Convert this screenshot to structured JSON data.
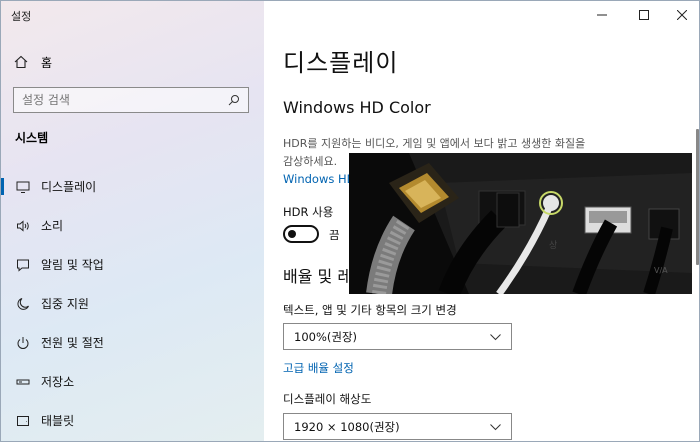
{
  "window": {
    "title": "설정"
  },
  "sidebar": {
    "home_label": "홈",
    "search_placeholder": "설정 검색",
    "section_title": "시스템",
    "items": [
      {
        "label": "디스플레이",
        "icon": "monitor-icon",
        "active": true
      },
      {
        "label": "소리",
        "icon": "speaker-icon"
      },
      {
        "label": "알림 및 작업",
        "icon": "notification-icon"
      },
      {
        "label": "집중 지원",
        "icon": "moon-icon"
      },
      {
        "label": "전원 및 절전",
        "icon": "power-icon"
      },
      {
        "label": "저장소",
        "icon": "storage-icon"
      },
      {
        "label": "태블릿",
        "icon": "tablet-icon"
      }
    ]
  },
  "main": {
    "title": "디스플레이",
    "hd_color_heading": "Windows HD Color",
    "hd_color_desc": "HDR를 지원하는 비디오, 게임 및 앱에서 보다 밝고 생생한 화질을 감상하세요.",
    "hd_color_link": "Windows HD",
    "hdr_label": "HDR 사용",
    "hdr_toggle_state": "끔",
    "scale_heading": "배율 및 레",
    "scale_label": "텍스트, 앱 및 기타 항목의 크기 변경",
    "scale_value": "100%(권장)",
    "advanced_scale_link": "고급 배율 설정",
    "resolution_label": "디스플레이 해상도",
    "resolution_value": "1920 × 1080(권장)"
  },
  "colors": {
    "accent": "#0063b1"
  }
}
